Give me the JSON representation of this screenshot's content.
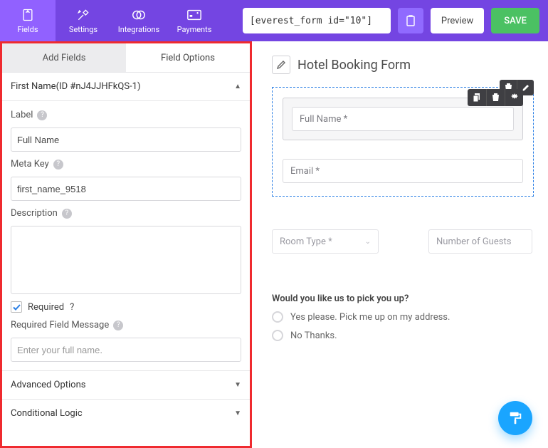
{
  "topbar": {
    "nav": {
      "fields": "Fields",
      "settings": "Settings",
      "integrations": "Integrations",
      "payments": "Payments"
    },
    "shortcode": "[everest_form id=\"10\"]",
    "preview": "Preview",
    "save": "SAVE"
  },
  "tabs": {
    "add_fields": "Add Fields",
    "field_options": "Field Options"
  },
  "field_header": "First Name(ID #nJ4JJHFkQS-1)",
  "labels": {
    "label": "Label",
    "meta_key": "Meta Key",
    "description": "Description",
    "required": "Required",
    "required_msg": "Required Field Message",
    "advanced": "Advanced Options",
    "conditional": "Conditional Logic"
  },
  "values": {
    "label": "Full Name",
    "meta_key": "first_name_9518",
    "description": "",
    "required_msg_placeholder": "Enter your full name."
  },
  "preview": {
    "form_title": "Hotel Booking Form",
    "fullname_placeholder": "Full Name *",
    "email_placeholder": "Email *",
    "room_type": "Room Type *",
    "guests": "Number of Guests",
    "question": "Would you like us to pick you up?",
    "opt_yes": "Yes please. Pick me up on my address.",
    "opt_no": "No Thanks."
  }
}
